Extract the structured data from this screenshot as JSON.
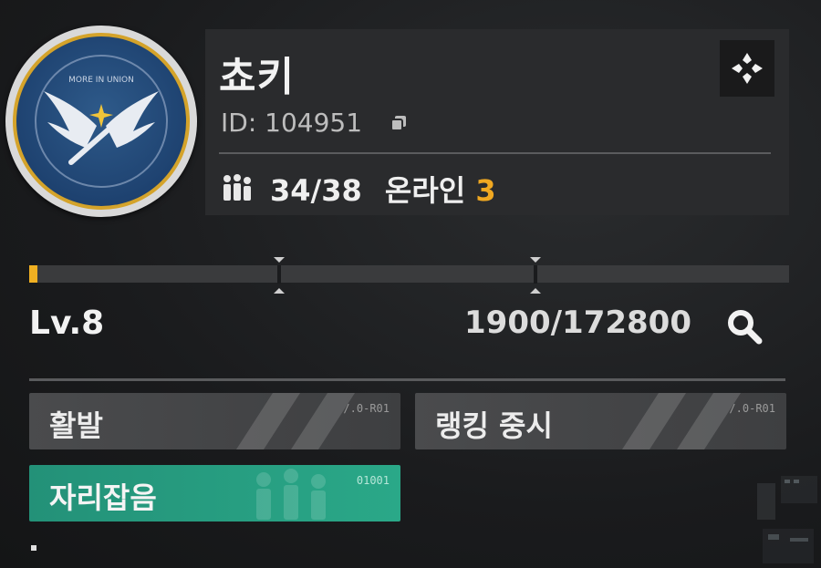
{
  "guild": {
    "name": "쵸키",
    "id": "ID: 104951",
    "members": "34/38",
    "online_label": "온라인",
    "online_count": "3",
    "emblem_text": "MORE IN UNION"
  },
  "progress": {
    "level": "Lv.8",
    "xp_text": "1900/172800",
    "xp_fraction": 0.011
  },
  "tags": [
    {
      "label": "활발",
      "code": "/.0-R01"
    },
    {
      "label": "랭킹 중시",
      "code": "/.0-R01"
    },
    {
      "label": "자리잡음",
      "code": "01001"
    }
  ],
  "colors": {
    "accent_orange": "#f0a821",
    "teal": "#2aa888",
    "panel": "#2a2b2d"
  },
  "icons": {
    "copy": "copy-icon",
    "settings": "crosshair-settings-icon",
    "members": "members-icon",
    "search": "search-icon"
  }
}
